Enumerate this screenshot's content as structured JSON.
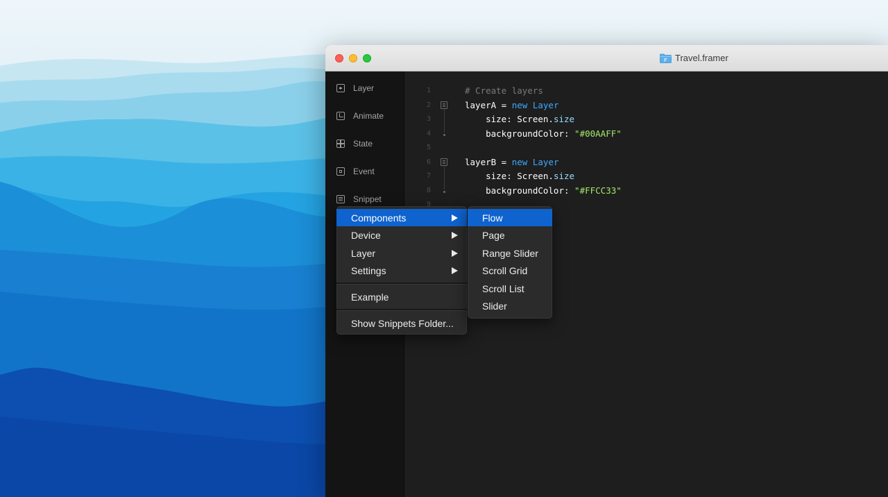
{
  "window": {
    "title": "Travel.framer"
  },
  "sidebar": {
    "items": [
      {
        "label": "Layer",
        "icon": "plus-box-icon"
      },
      {
        "label": "Animate",
        "icon": "animate-icon"
      },
      {
        "label": "State",
        "icon": "grid-icon"
      },
      {
        "label": "Event",
        "icon": "event-icon"
      },
      {
        "label": "Snippet",
        "icon": "snippet-icon"
      }
    ]
  },
  "editor": {
    "line_numbers": [
      "1",
      "2",
      "3",
      "4",
      "5",
      "6",
      "7",
      "8",
      "9"
    ],
    "lines": [
      {
        "parts": [
          {
            "t": "# Create layers",
            "c": "tk-comment"
          }
        ]
      },
      {
        "parts": [
          {
            "t": "layerA = "
          },
          {
            "t": "new",
            "c": "tk-kw"
          },
          {
            "t": " "
          },
          {
            "t": "Layer",
            "c": "tk-class"
          }
        ]
      },
      {
        "parts": [
          {
            "t": "    size: Screen."
          },
          {
            "t": "size",
            "c": "tk-prop"
          }
        ]
      },
      {
        "parts": [
          {
            "t": "    backgroundColor: "
          },
          {
            "t": "\"#00AAFF\"",
            "c": "tk-str"
          }
        ]
      },
      {
        "parts": []
      },
      {
        "parts": [
          {
            "t": "layerB = "
          },
          {
            "t": "new",
            "c": "tk-kw"
          },
          {
            "t": " "
          },
          {
            "t": "Layer",
            "c": "tk-class"
          }
        ]
      },
      {
        "parts": [
          {
            "t": "    size: Screen."
          },
          {
            "t": "size",
            "c": "tk-prop"
          }
        ]
      },
      {
        "parts": [
          {
            "t": "    backgroundColor: "
          },
          {
            "t": "\"#FFCC33\"",
            "c": "tk-str"
          }
        ]
      },
      {
        "parts": []
      }
    ]
  },
  "snippet_menu": {
    "items": [
      {
        "label": "Components",
        "submenu": true,
        "highlighted": true
      },
      {
        "label": "Device",
        "submenu": true
      },
      {
        "label": "Layer",
        "submenu": true
      },
      {
        "label": "Settings",
        "submenu": true
      },
      {
        "label": "Example",
        "submenu": false
      },
      {
        "label": "Show Snippets Folder...",
        "submenu": false
      }
    ]
  },
  "components_submenu": {
    "items": [
      {
        "label": "Flow",
        "highlighted": true
      },
      {
        "label": "Page"
      },
      {
        "label": "Range Slider"
      },
      {
        "label": "Scroll Grid"
      },
      {
        "label": "Scroll List"
      },
      {
        "label": "Slider"
      }
    ]
  },
  "colors": {
    "menu_highlight": "#0f63ce",
    "string": "#a6e86a",
    "keyword": "#3fa9ff"
  }
}
